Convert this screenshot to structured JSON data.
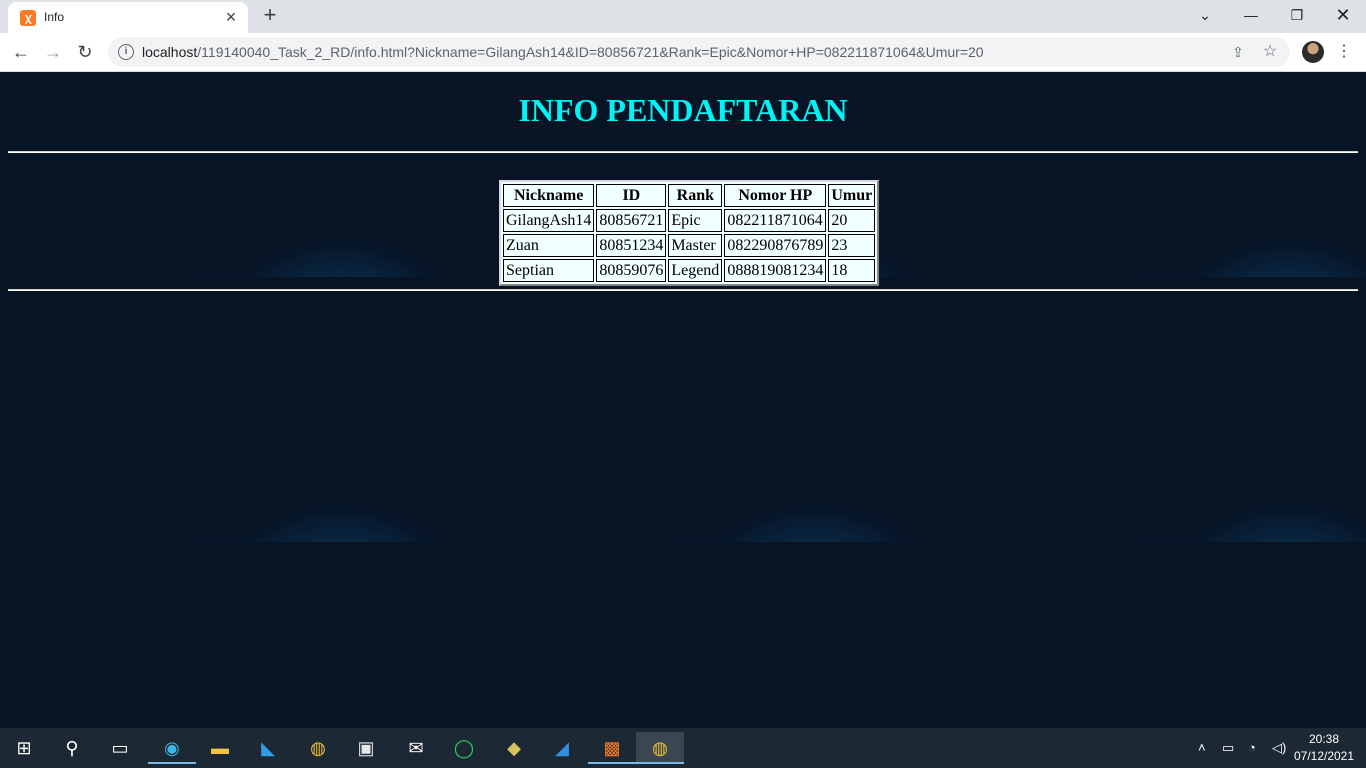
{
  "browser": {
    "tab_title": "Info",
    "tab_favicon": "xampp-icon",
    "url_host": "localhost",
    "url_path": "/119140040_Task_2_RD/info.html?Nickname=GilangAsh14&ID=80856721&Rank=Epic&Nomor+HP=082211871064&Umur=20"
  },
  "page": {
    "title": "INFO PENDAFTARAN",
    "title_color": "#00f3f5",
    "table": {
      "headers": [
        "Nickname",
        "ID",
        "Rank",
        "Nomor HP",
        "Umur"
      ],
      "rows": [
        [
          "GilangAsh14",
          "80856721",
          "Epic",
          "082211871064",
          "20"
        ],
        [
          "Zuan",
          "80851234",
          "Master",
          "082290876789",
          "23"
        ],
        [
          "Septian",
          "80859076",
          "Legend",
          "088819081234",
          "18"
        ]
      ]
    }
  },
  "taskbar": {
    "apps": [
      "start-icon",
      "search-icon",
      "task-view-icon",
      "edge-icon",
      "file-explorer-icon",
      "vscode-icon",
      "chrome-icon",
      "store-icon",
      "mail-icon",
      "whatsapp-icon",
      "app-icon",
      "app-blue-icon",
      "xampp-icon",
      "chrome-profile-icon"
    ],
    "clock_time": "20:38",
    "clock_date": "07/12/2021"
  }
}
